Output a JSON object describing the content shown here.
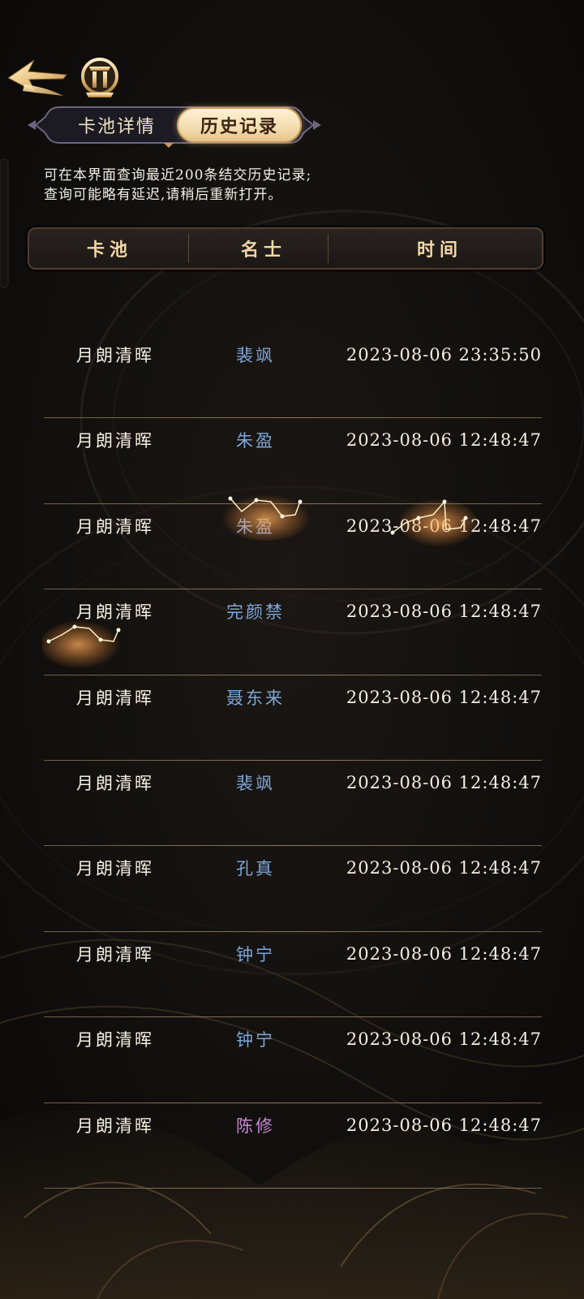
{
  "tabs": {
    "detail_label": "卡池详情",
    "history_label": "历史记录",
    "active": "history"
  },
  "notice": {
    "line1": "可在本界面查询最近200条结交历史记录;",
    "line2": "查询可能略有延迟,请稍后重新打开。"
  },
  "table": {
    "headers": {
      "pool": "卡池",
      "name": "名士",
      "time": "时间"
    },
    "rows": [
      {
        "pool": "月朗清晖",
        "name": "裴飒",
        "name_color": "#7fa6d8",
        "time": "2023-08-06 23:35:50"
      },
      {
        "pool": "月朗清晖",
        "name": "朱盈",
        "name_color": "#7fa6d8",
        "time": "2023-08-06 12:48:47"
      },
      {
        "pool": "月朗清晖",
        "name": "朱盈",
        "name_color": "#7fa6d8",
        "time": "2023-08-06 12:48:47"
      },
      {
        "pool": "月朗清晖",
        "name": "完颜禁",
        "name_color": "#7fa6d8",
        "time": "2023-08-06 12:48:47"
      },
      {
        "pool": "月朗清晖",
        "name": "聂东来",
        "name_color": "#7fa6d8",
        "time": "2023-08-06 12:48:47"
      },
      {
        "pool": "月朗清晖",
        "name": "裴飒",
        "name_color": "#7fa6d8",
        "time": "2023-08-06 12:48:47"
      },
      {
        "pool": "月朗清晖",
        "name": "孔真",
        "name_color": "#7fa6d8",
        "time": "2023-08-06 12:48:47"
      },
      {
        "pool": "月朗清晖",
        "name": "钟宁",
        "name_color": "#7fa6d8",
        "time": "2023-08-06 12:48:47"
      },
      {
        "pool": "月朗清晖",
        "name": "钟宁",
        "name_color": "#7fa6d8",
        "time": "2023-08-06 12:48:47"
      },
      {
        "pool": "月朗清晖",
        "name": "陈修",
        "name_color": "#c78ad6",
        "time": "2023-08-06 12:48:47"
      }
    ]
  },
  "colors": {
    "background": "#0e0c0a",
    "gold_accent": "#f3d8a6",
    "rare_name": "#7fa6d8",
    "epic_name": "#c78ad6"
  },
  "icons": {
    "back": "winged-arrow-back-icon",
    "home": "gold-arch-home-icon"
  }
}
